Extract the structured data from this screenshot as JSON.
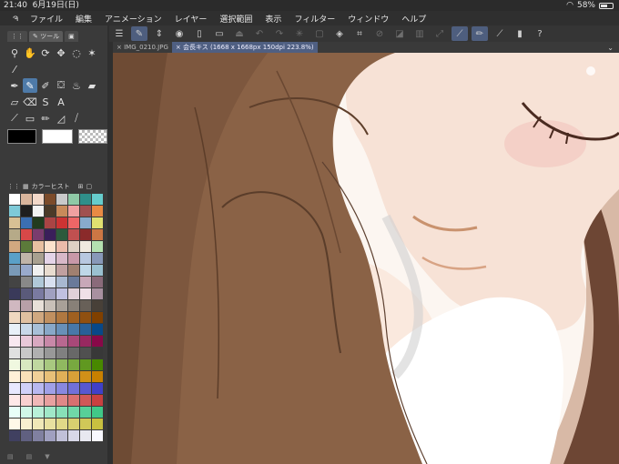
{
  "status": {
    "time": "21:40",
    "date": "6月19日(日)",
    "battery": "58%",
    "battery_level": 0.58
  },
  "menu": [
    "ファイル",
    "編集",
    "アニメーション",
    "レイヤー",
    "選択範囲",
    "表示",
    "フィルター",
    "ウィンドウ",
    "ヘルプ"
  ],
  "toolbar": {
    "icons": [
      "menu-icon",
      "edit-icon",
      "updown-icon",
      "camera-icon",
      "new-doc-icon",
      "open-icon",
      "save-icon",
      "undo-icon",
      "redo-icon",
      "spinner-icon",
      "fill-icon",
      "transform-icon",
      "deselect-icon",
      "invert-icon",
      "lock-icon",
      "expand-icon",
      "pen-check-icon",
      "brush-icon",
      "ruler-icon",
      "device-icon",
      "help-icon"
    ]
  },
  "tool_panel": {
    "tab_label": "ツール",
    "tools": [
      "magnify-icon",
      "hand-icon",
      "rotate-icon",
      "move-icon",
      "lasso-icon",
      "wand-icon",
      "eyedropper-icon",
      "",
      "",
      "",
      "",
      "",
      "pen-icon",
      "pencil-icon",
      "brush-icon",
      "airbrush-icon",
      "blend-icon",
      "fill-icon",
      "gradient-icon",
      "erase-icon",
      "figure-icon",
      "text-icon",
      "",
      "",
      "line-icon",
      "frame-icon",
      "pen2-icon",
      "fill2-icon",
      "ruler-icon",
      ""
    ]
  },
  "color_panel": {
    "tab_label": "カラーヒスト",
    "colors": [
      "#ffffff",
      "#d9b59c",
      "#f2d8c8",
      "#7c4b2a",
      "#c9c9c9",
      "#8fc9a6",
      "#2f8f8a",
      "#66cccc",
      "#7ecad8",
      "#1f1f1f",
      "#f2f2f2",
      "#4b3a28",
      "#c88a5a",
      "#f0a0a0",
      "#a05050",
      "#e88a44",
      "#d8c094",
      "#3b6fb2",
      "#223b1e",
      "#aa4444",
      "#cc3333",
      "#ee6666",
      "#88aacc",
      "#e0e070",
      "#b6aa88",
      "#d84848",
      "#7a3c6e",
      "#3a1f5a",
      "#2c5a3c",
      "#c05050",
      "#8a2a2a",
      "#cc7744",
      "#d2a880",
      "#5c7a3a",
      "#e8c0a0",
      "#fbe2cc",
      "#ebbbaa",
      "#ddd0c4",
      "#f0eadf",
      "#b4e0b0",
      "#5aa0c8",
      "#c0b4a8",
      "#a8a090",
      "#e4d4e8",
      "#d8b8c8",
      "#c898a8",
      "#b8c8e0",
      "#8898b8",
      "#7a9ab8",
      "#99aacc",
      "#f0f0f0",
      "#e8dcd0",
      "#c0a0a0",
      "#a08070",
      "#bfd8e8",
      "#9ac0d0",
      "#444444",
      "#888888",
      "#b0c8d8",
      "#d8e0f0",
      "#a8b8d0",
      "#6a7a9a",
      "#c8a8b8",
      "#8a6a7a",
      "#3a3a5a",
      "#5a5a7a",
      "#7a7aa0",
      "#a0a0c0",
      "#c0c0e0",
      "#e0d0d8",
      "#f0e0e8",
      "#a890a0",
      "#d0b8c0",
      "#b8a0a8",
      "#e8e0d8",
      "#c8c0b8",
      "#a8a098",
      "#888078",
      "#686058",
      "#484038",
      "#f0d8c0",
      "#e0c0a0",
      "#d0a880",
      "#c09060",
      "#b07840",
      "#a06020",
      "#905010",
      "#804000",
      "#e8f0f8",
      "#c8d8e8",
      "#a8c0d8",
      "#88a8c8",
      "#6890b8",
      "#4878a8",
      "#286098",
      "#084888",
      "#f8e8f0",
      "#e8c8d8",
      "#d8a8c0",
      "#c888a8",
      "#b86890",
      "#a84878",
      "#982860",
      "#880848",
      "#e0e0e0",
      "#c8c8c8",
      "#b0b0b0",
      "#989898",
      "#808080",
      "#686868",
      "#505050",
      "#383838",
      "#f0f8e0",
      "#d8e8c0",
      "#c0d8a0",
      "#a8c880",
      "#90b860",
      "#78a840",
      "#609820",
      "#488800",
      "#fff0d8",
      "#f8e0b8",
      "#f0d098",
      "#e8c078",
      "#e0b058",
      "#d8a038",
      "#d09018",
      "#c88000",
      "#e8e8ff",
      "#d0d0f8",
      "#b8b8f0",
      "#a0a0e8",
      "#8888e0",
      "#7070d8",
      "#5858d0",
      "#4040c8",
      "#ffe8e8",
      "#f8d0d0",
      "#f0b8b8",
      "#e8a0a0",
      "#e08888",
      "#d87070",
      "#d05858",
      "#c84040",
      "#e8fff8",
      "#d0f8e8",
      "#b8f0d8",
      "#a0e8c8",
      "#88e0b8",
      "#70d8a8",
      "#58d098",
      "#40c888",
      "#fff8e8",
      "#f8f0d0",
      "#f0e8b8",
      "#e8e0a0",
      "#e0d888",
      "#d8d070",
      "#d0c858",
      "#c8c040",
      "#404060",
      "#606080",
      "#8080a0",
      "#a0a0c0",
      "#c0c0d8",
      "#d8d8e8",
      "#e8e8f0",
      "#f8f8ff"
    ]
  },
  "doc_tabs": [
    "IMG_0210.JPG",
    "会長キス (1668 x 1668px 150dpi 223.8%)"
  ]
}
